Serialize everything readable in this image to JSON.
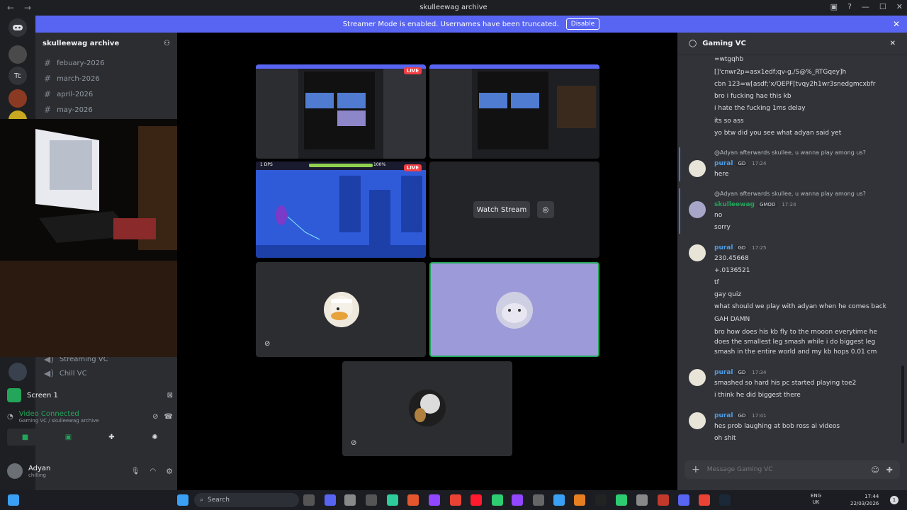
{
  "window": {
    "title": "skulleewag archive",
    "nav_back": "←",
    "nav_fwd": "→"
  },
  "banner": {
    "text": "Streamer Mode is enabled. Usernames have been truncated.",
    "disable": "Disable",
    "close": "✕"
  },
  "guilds": {
    "tc_label": "Tc"
  },
  "sidebar": {
    "server_name": "skulleewag archive",
    "channels": [
      {
        "name": "febuary-2026"
      },
      {
        "name": "march-2026"
      },
      {
        "name": "april-2026"
      },
      {
        "name": "may-2026"
      }
    ],
    "voice_channels": [
      {
        "name": "Streaming VC"
      },
      {
        "name": "Chill VC"
      }
    ]
  },
  "voice_panel": {
    "screen_label": "Screen 1",
    "status": "Video Connected",
    "location": "Gaming VC / skulleewag archive"
  },
  "user_panel": {
    "name": "Adyan",
    "status": "chilling"
  },
  "stage": {
    "live": "LIVE",
    "watch_stream": "Watch Stream",
    "game_hud_left": "1 DPS",
    "game_hud_right": "100%"
  },
  "chat": {
    "title": "Gaming VC",
    "close": "✕",
    "top_lines": [
      "=wtgqhb",
      "[]'cnwr2p=asx1edf;qv-g,/S@%_RTGqey]h",
      "cbn 123=w[asdf;'x/QEPF[tvqy2h1wr3snedgmcxbfr",
      "bro i fucking hae this kb",
      "i hate the fucking 1ms delay",
      "its so ass",
      "yo btw did you see what adyan said yet"
    ],
    "reply1": "@Adyan afterwards skullee, u wanna play among us?",
    "msg1": {
      "author": "pural",
      "badge": "GD",
      "time": "17:24",
      "lines": [
        "here"
      ]
    },
    "reply2": "@Adyan afterwards skullee, u wanna play among us?",
    "msg2": {
      "author": "skulleewag",
      "badge": "GMOD",
      "time": "17:24",
      "lines": [
        "no",
        "sorry"
      ]
    },
    "msg3": {
      "author": "pural",
      "badge": "GD",
      "time": "17:25",
      "lines": [
        "230.45668",
        "+.0136521",
        "tf",
        "gay quiz",
        "what should we play with adyan when he comes back",
        "GAH DAMN",
        "bro how does his kb fly to the mooon everytime he does the smallest leg smash while i do biggest leg smash in the entire world and my kb hops 0.01 cm"
      ]
    },
    "msg4": {
      "author": "pural",
      "badge": "GD",
      "time": "17:34",
      "lines": [
        "smashed so hard his pc started playing toe2",
        "i think he did biggest there"
      ]
    },
    "msg5": {
      "author": "pural",
      "badge": "GD",
      "time": "17:41",
      "lines": [
        "hes prob laughing at bob ross ai videos",
        "oh shit"
      ]
    },
    "input_placeholder": "Message Gaming VC"
  },
  "taskbar": {
    "search": "Search",
    "lang_top": "ENG",
    "lang_bottom": "UK",
    "time": "17:44",
    "date": "22/03/2026",
    "notif_count": "1"
  },
  "colors": {
    "accent": "#5865f2",
    "live": "#f23f43",
    "green": "#23a55a",
    "chat_bg": "#313338",
    "name_pural": "#4e9ce6",
    "name_skulleewag": "#23a55a"
  }
}
